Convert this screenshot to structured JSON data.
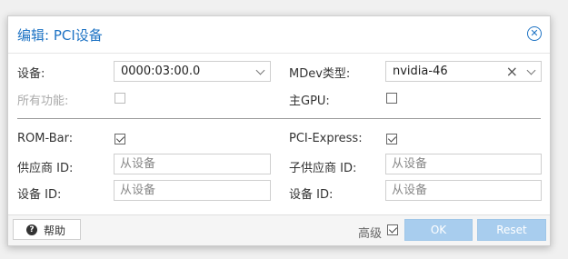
{
  "dialog": {
    "title": "编辑: PCI设备",
    "close_icon": "close-circle-icon"
  },
  "form": {
    "device": {
      "label": "设备:",
      "value": "0000:03:00.0"
    },
    "mdev_type": {
      "label": "MDev类型:",
      "value": "nvidia-46"
    },
    "all_functions": {
      "label": "所有功能:",
      "checked": false,
      "disabled": true
    },
    "primary_gpu": {
      "label": "主GPU:",
      "checked": false
    },
    "rom_bar": {
      "label": "ROM-Bar:",
      "checked": true
    },
    "pci_express": {
      "label": "PCI-Express:",
      "checked": true
    },
    "vendor_id": {
      "label": "供应商 ID:",
      "placeholder": "从设备"
    },
    "sub_vendor_id": {
      "label": "子供应商 ID:",
      "placeholder": "从设备"
    },
    "device_id": {
      "label": "设备 ID:",
      "placeholder": "从设备"
    },
    "sub_device_id": {
      "label": "设备 ID:",
      "placeholder": "从设备"
    }
  },
  "footer": {
    "help_label": "帮助",
    "help_icon": "question-circle-icon",
    "advanced_label": "高级",
    "advanced_checked": true,
    "ok_label": "OK",
    "reset_label": "Reset"
  },
  "colors": {
    "title": "#1e73c4",
    "disabled_button": "#a8cdee"
  }
}
